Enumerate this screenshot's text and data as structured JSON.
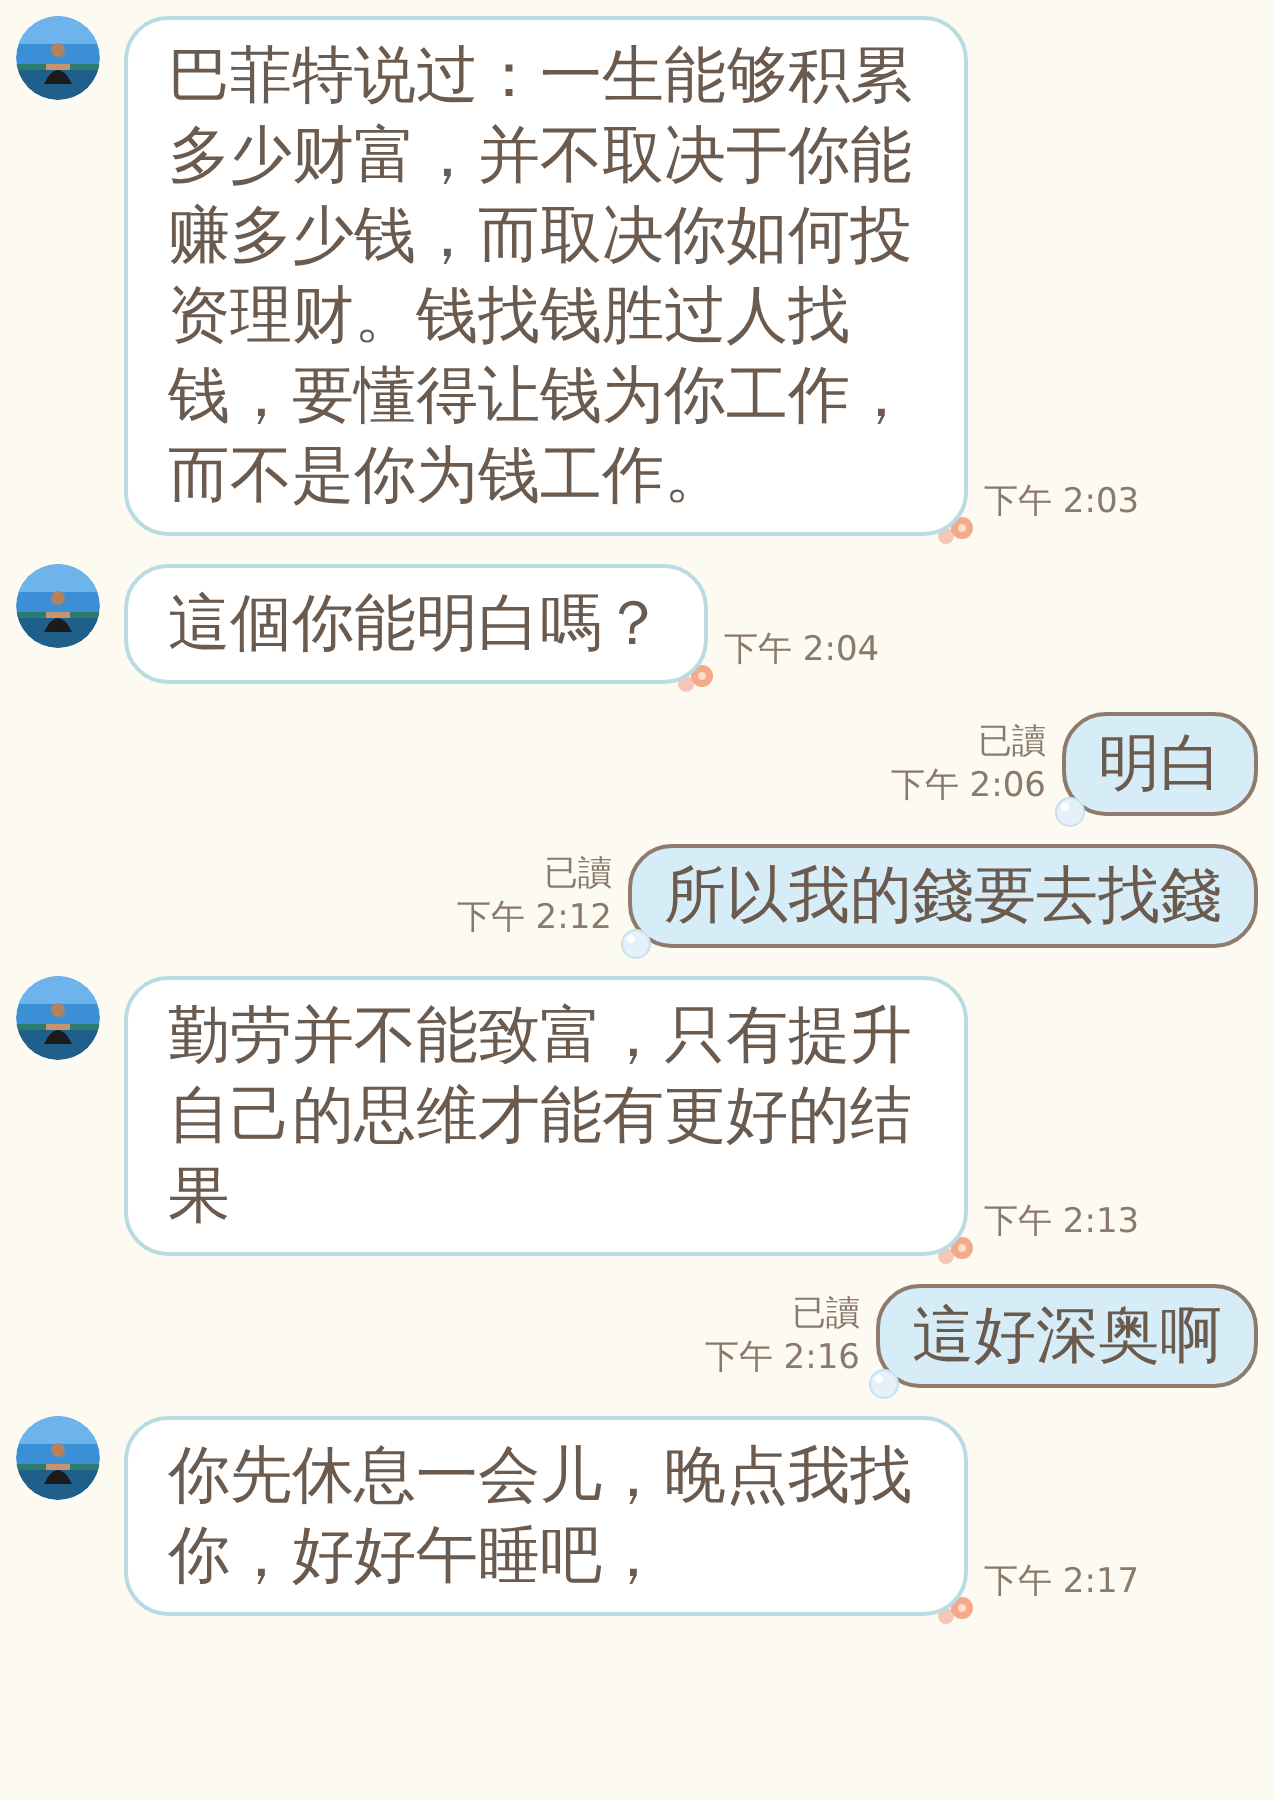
{
  "messages": [
    {
      "kind": "in",
      "text": "巴菲特说过：一生能够积累多少财富，并不取决于你能赚多少钱，而取决你如何投资理财。钱找钱胜过人找钱，要懂得让钱为你工作，而不是你为钱工作。",
      "time": "下午 2:03"
    },
    {
      "kind": "in",
      "text": "這個你能明白嗎？",
      "time": "下午 2:04"
    },
    {
      "kind": "out",
      "text": "明白",
      "time": "下午 2:06",
      "read": "已讀"
    },
    {
      "kind": "out",
      "text": "所以我的錢要去找錢",
      "time": "下午 2:12",
      "read": "已讀"
    },
    {
      "kind": "in",
      "text": "勤劳并不能致富，只有提升自己的思维才能有更好的结果",
      "time": "下午 2:13"
    },
    {
      "kind": "out",
      "text": "這好深奥啊",
      "time": "下午 2:16",
      "read": "已讀"
    },
    {
      "kind": "in",
      "text": "你先休息一会儿，晚点我找你，好好午睡吧，",
      "time": "下午 2:17"
    }
  ]
}
